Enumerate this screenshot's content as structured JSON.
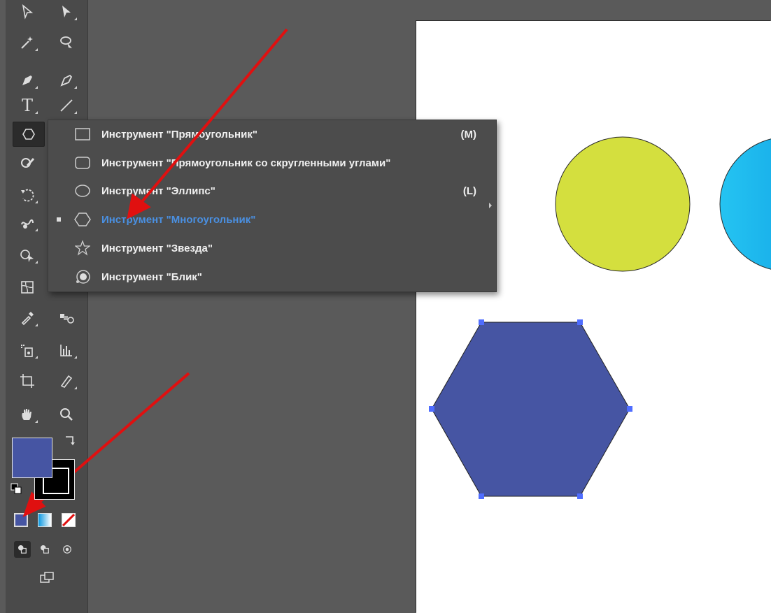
{
  "toolbar": {
    "tools": [
      "selection-icon",
      "direct-selection-icon",
      "magic-wand-icon",
      "lasso-icon",
      "pen-icon",
      "curvature-icon",
      "type-icon",
      "line-icon",
      "polygon-icon",
      "shaper-icon",
      "rotate-icon",
      "warp-icon",
      "shape-builder-icon",
      "mesh-icon",
      "eyedropper-icon",
      "blend-icon",
      "symbol-sprayer-icon",
      "graph-icon",
      "artboard-icon",
      "slice-icon",
      "hand-icon",
      "zoom-icon"
    ],
    "text_tool_glyph": "T"
  },
  "flyout": {
    "items": [
      {
        "label": "Инструмент \"Прямоугольник\"",
        "shortcut": "(M)",
        "icon": "rectangle-icon"
      },
      {
        "label": "Инструмент \"Прямоугольник со скругленными углами\"",
        "shortcut": "",
        "icon": "rounded-rectangle-icon"
      },
      {
        "label": "Инструмент \"Эллипс\"",
        "shortcut": "(L)",
        "icon": "ellipse-icon"
      },
      {
        "label": "Инструмент \"Многоугольник\"",
        "shortcut": "",
        "icon": "polygon-icon",
        "selected": true
      },
      {
        "label": "Инструмент \"Звезда\"",
        "shortcut": "",
        "icon": "star-icon"
      },
      {
        "label": "Инструмент \"Блик\"",
        "shortcut": "",
        "icon": "flare-icon"
      }
    ]
  },
  "colors": {
    "fill": "#4655a3",
    "stroke": "#000000",
    "selected_text": "#4a90e2",
    "circle_yellow": "#d4df3e",
    "circle_cyan": "#0ab8f0",
    "hexagon": "#4655a3",
    "arrow": "#e01010"
  }
}
